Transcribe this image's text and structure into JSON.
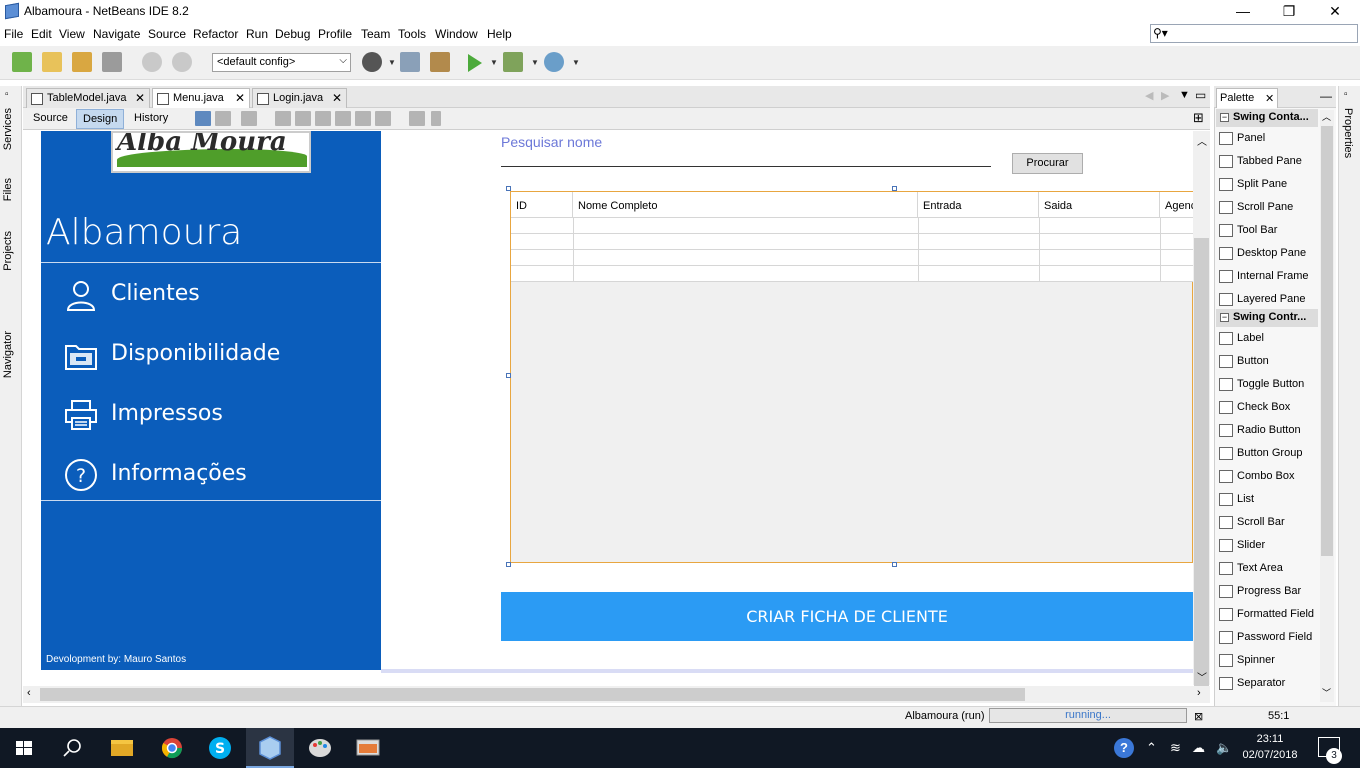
{
  "window": {
    "title": "Albamoura - NetBeans IDE 8.2",
    "minimize": "—",
    "maximize": "❐",
    "close": "✕"
  },
  "menu": [
    "File",
    "Edit",
    "View",
    "Navigate",
    "Source",
    "Refactor",
    "Run",
    "Debug",
    "Profile",
    "Team",
    "Tools",
    "Window",
    "Help"
  ],
  "toolbar": {
    "config_value": "<default config>"
  },
  "left_strip": {
    "tabs": [
      "Services",
      "Files",
      "Projects",
      "Navigator"
    ]
  },
  "editor_tabs": [
    {
      "label": "TableModel.java",
      "active": false
    },
    {
      "label": "Menu.java",
      "active": true
    },
    {
      "label": "Login.java",
      "active": false
    }
  ],
  "view_buttons": {
    "source": "Source",
    "design": "Design",
    "history": "History"
  },
  "form": {
    "logo_text": "Alba Moura",
    "brand": "Albamoura",
    "nav": [
      {
        "label": "Clientes",
        "icon": "user-icon"
      },
      {
        "label": "Disponibilidade",
        "icon": "folder-icon"
      },
      {
        "label": "Impressos",
        "icon": "printer-icon"
      },
      {
        "label": "Informações",
        "icon": "help-icon"
      }
    ],
    "dev_credit": "Devolopment by: Mauro Santos",
    "search_label": "Pesquisar nome",
    "search_button": "Procurar",
    "table_headers": [
      "ID",
      "Nome Completo",
      "Entrada",
      "Saida",
      "Agenc"
    ],
    "create_button": "CRIAR FICHA DE CLIENTE"
  },
  "palette": {
    "tab_label": "Palette",
    "categories": [
      {
        "name": "Swing Conta...",
        "items": [
          "Panel",
          "Tabbed Pane",
          "Split Pane",
          "Scroll Pane",
          "Tool Bar",
          "Desktop Pane",
          "Internal Frame",
          "Layered Pane"
        ]
      },
      {
        "name": "Swing Contr...",
        "items": [
          "Label",
          "Button",
          "Toggle Button",
          "Check Box",
          "Radio Button",
          "Button Group",
          "Combo Box",
          "List",
          "Scroll Bar",
          "Slider",
          "Text Area",
          "Progress Bar",
          "Formatted Field",
          "Password Field",
          "Spinner",
          "Separator"
        ]
      }
    ]
  },
  "right_strip": {
    "tab": "Properties"
  },
  "status": {
    "run_label": "Albamoura (run)",
    "progress_text": "running...",
    "position": "55:1"
  },
  "taskbar": {
    "time": "23:11",
    "date": "02/07/2018",
    "notification_count": "3"
  },
  "colors": {
    "sidebar": "#0b5dbb",
    "create_button": "#2b9bf4",
    "search_label": "#6c78d8"
  }
}
